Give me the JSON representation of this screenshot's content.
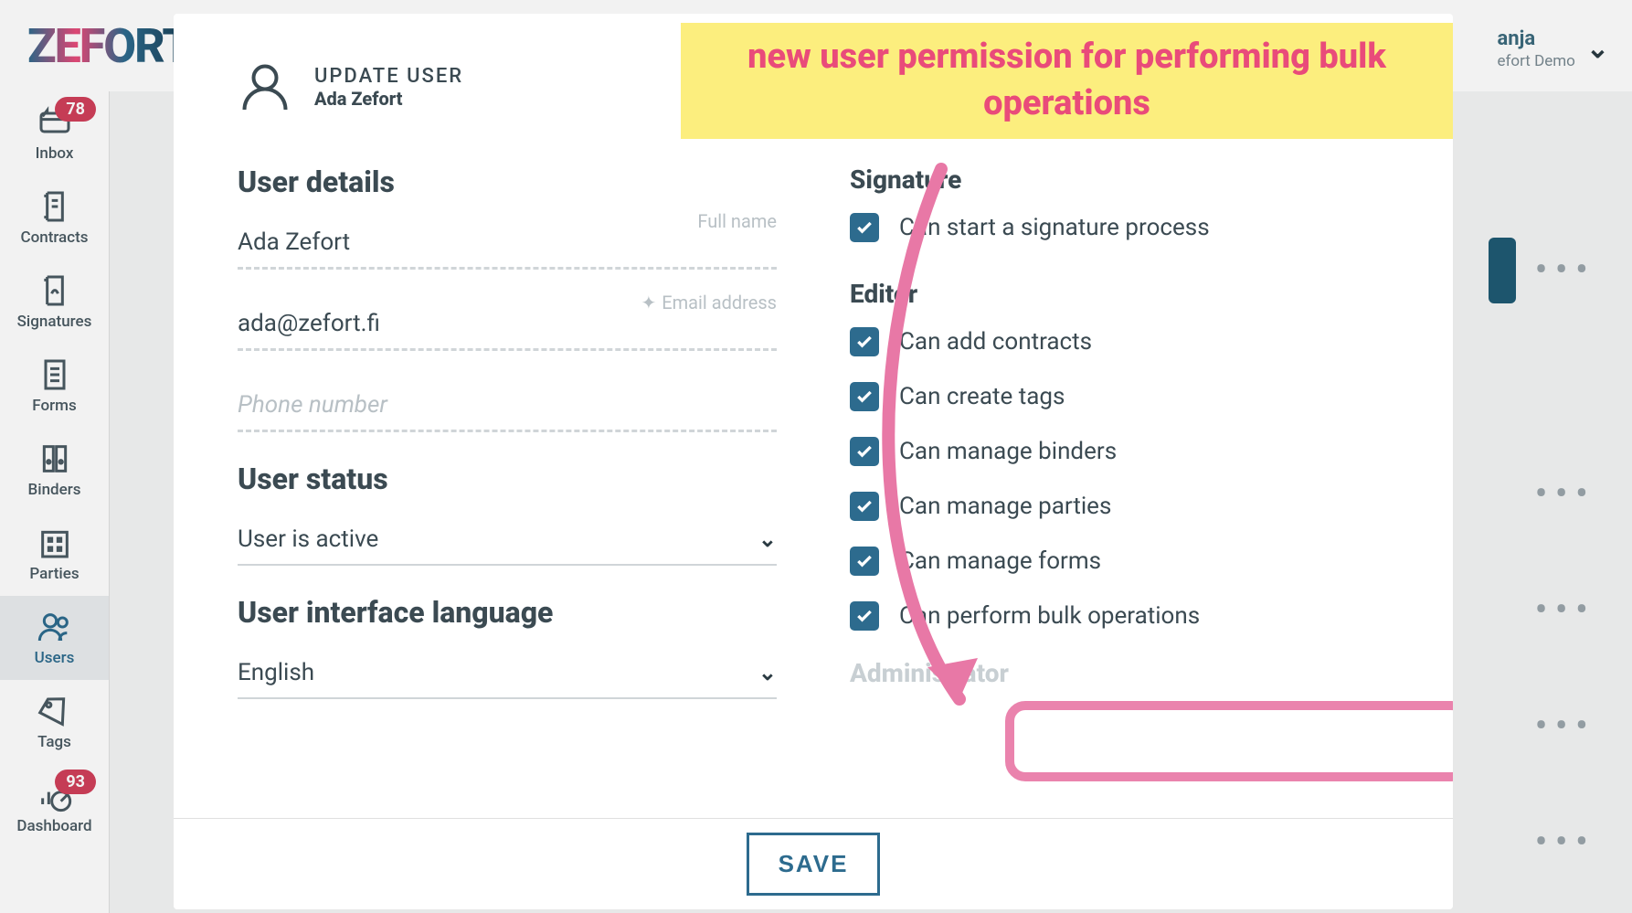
{
  "brand": "ZEFORT",
  "topuser": {
    "name": "anja",
    "sub": "efort Demo"
  },
  "sidebar": {
    "items": [
      {
        "label": "Inbox",
        "badge": "78"
      },
      {
        "label": "Contracts"
      },
      {
        "label": "Signatures"
      },
      {
        "label": "Forms"
      },
      {
        "label": "Binders"
      },
      {
        "label": "Parties"
      },
      {
        "label": "Users"
      },
      {
        "label": "Tags"
      },
      {
        "label": "Dashboard",
        "badge": "93"
      }
    ]
  },
  "modal": {
    "title": "UPDATE USER",
    "subtitle": "Ada Zefort",
    "sections": {
      "details": "User details",
      "status": "User status",
      "lang": "User interface language"
    },
    "fields": {
      "fullname_label": "Full name",
      "fullname_value": "Ada Zefort",
      "email_label": "Email address",
      "email_value": "ada@zefort.fi",
      "phone_placeholder": "Phone number",
      "status_value": "User is active",
      "lang_value": "English"
    },
    "perm_sections": {
      "signature": "Signature",
      "editor": "Editor",
      "admin": "Administrator"
    },
    "perms": {
      "sig_start": "Can start a signature process",
      "ed_add": "Can add contracts",
      "ed_tags": "Can create tags",
      "ed_binders": "Can manage binders",
      "ed_parties": "Can manage parties",
      "ed_forms": "Can manage forms",
      "ed_bulk": "Can perform bulk operations"
    },
    "save": "SAVE"
  },
  "annotation": {
    "text": "new user permission for performing bulk operations"
  }
}
